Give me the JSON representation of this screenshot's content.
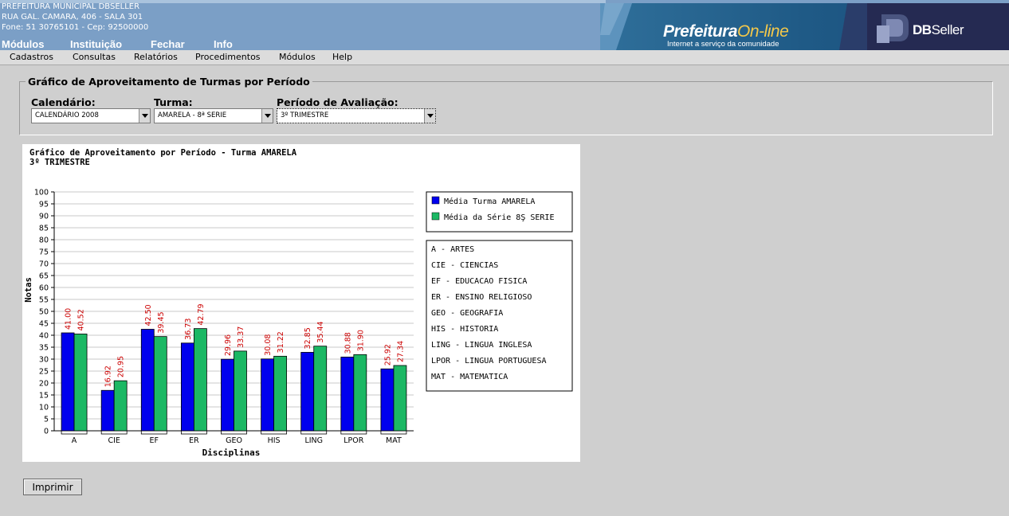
{
  "org": {
    "line1": "PREFEITURA MUNICIPAL DBSELLER",
    "line2": "RUA GAL. CAMARA, 406 - SALA 301",
    "line3": "Fone: 51 30765101  -  Cep: 92500000"
  },
  "top_nav": [
    "Módulos",
    "Instituição",
    "Fechar",
    "Info"
  ],
  "banner": {
    "brand_main": "Prefeitura",
    "brand_suffix": "On-line",
    "brand_tagline": "Internet a serviço da comunidade",
    "dbseller_bold": "DB",
    "dbseller_rest": "Seller",
    "accent_color": "#f4c84a",
    "logo_icon": "dbseller-logo-icon"
  },
  "menu": [
    "Cadastros",
    "Consultas",
    "Relatórios",
    "Procedimentos",
    "Módulos",
    "Help"
  ],
  "filters": {
    "legend": "Gráfico de Aproveitamento de Turmas por Período",
    "calendario_label": "Calendário:",
    "calendario_value": "CALENDÁRIO 2008",
    "turma_label": "Turma:",
    "turma_value": "AMARELA - 8ª SERIE",
    "periodo_label": "Período de Avaliação:",
    "periodo_value": "3º TRIMESTRE"
  },
  "chart_data": {
    "type": "bar",
    "title": "Gráfico de Aproveitamento por Período - Turma AMARELA",
    "subtitle": "3º TRIMESTRE",
    "xlabel": "Disciplinas",
    "ylabel": "Notas",
    "ylim": [
      0,
      100
    ],
    "ytick_step": 5,
    "grid": true,
    "legend_position": "right",
    "categories": [
      "A",
      "CIE",
      "EF",
      "ER",
      "GEO",
      "HIS",
      "LING",
      "LPOR",
      "MAT"
    ],
    "series": [
      {
        "name": "Média Turma AMARELA",
        "color": "#0000ee",
        "values": [
          41.0,
          16.92,
          42.5,
          36.73,
          29.96,
          30.08,
          32.85,
          30.88,
          25.92
        ]
      },
      {
        "name": "Média da Série 8Ş SERIE",
        "color": "#1cb864",
        "values": [
          40.52,
          20.95,
          39.45,
          42.79,
          33.37,
          31.22,
          35.44,
          31.9,
          27.34
        ]
      }
    ],
    "value_label_color": "#cc0000",
    "abbreviations": [
      "A - ARTES",
      "CIE - CIENCIAS",
      "EF - EDUCACAO FISICA",
      "ER - ENSINO RELIGIOSO",
      "GEO - GEOGRAFIA",
      "HIS - HISTORIA",
      "LING - LINGUA INGLESA",
      "LPOR - LINGUA PORTUGUESA",
      "MAT - MATEMATICA"
    ]
  },
  "print_button": "Imprimir"
}
